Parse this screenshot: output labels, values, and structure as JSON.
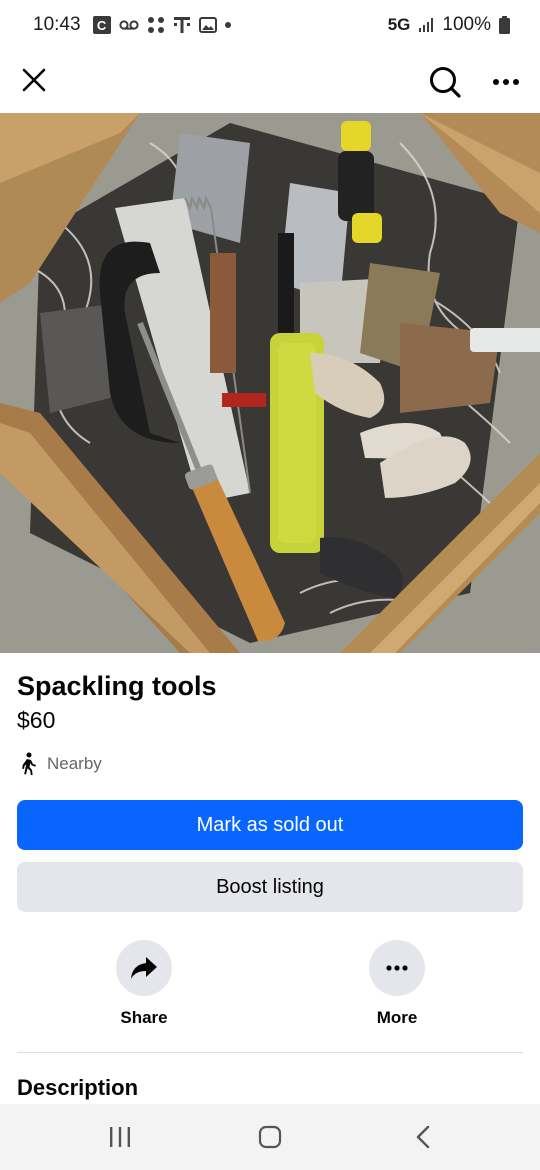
{
  "status_bar": {
    "time": "10:43",
    "carrier_badge": "C",
    "network": "5G",
    "battery": "100%"
  },
  "app_bar": {
    "close_icon": "close-icon",
    "search_icon": "search-icon",
    "more_icon": "more-horizontal-icon"
  },
  "listing": {
    "title": "Spackling tools",
    "price": "$60",
    "location": "Nearby",
    "photo_subject": "Basket of spackling tools, saws, and putty knives"
  },
  "buttons": {
    "primary": "Mark as sold out",
    "secondary": "Boost listing"
  },
  "actions": [
    {
      "label": "Share",
      "icon": "share-arrow-icon"
    },
    {
      "label": "More",
      "icon": "more-horizontal-icon"
    }
  ],
  "sections": {
    "description_heading": "Description"
  },
  "colors": {
    "primary_button": "#0866ff",
    "secondary_button": "#e4e6eb",
    "secondary_text": "#65676b"
  }
}
